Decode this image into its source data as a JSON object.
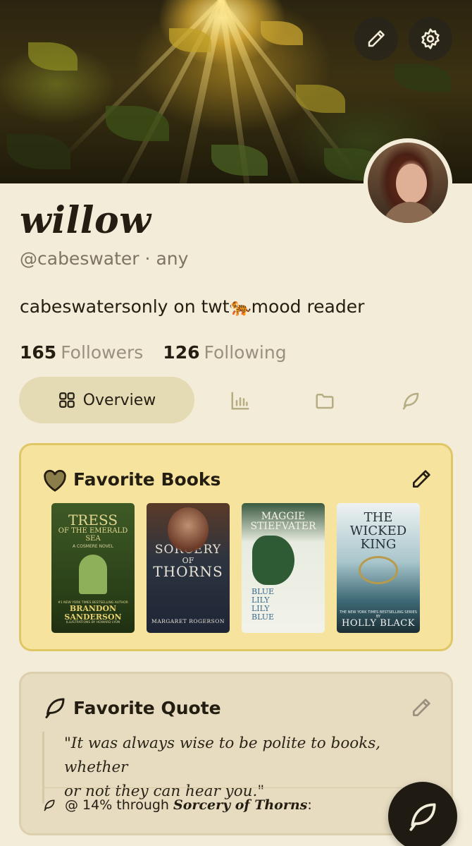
{
  "profile": {
    "display_name": "willow",
    "handle": "@cabeswater",
    "pronouns": "any",
    "handle_separator": "·",
    "bio": "cabeswatersonly on twt🐅mood reader",
    "followers_count": "165",
    "followers_label": "Followers",
    "following_count": "126",
    "following_label": "Following"
  },
  "header_actions": {
    "edit_icon": "pencil-icon",
    "settings_icon": "gear-icon"
  },
  "tabs": [
    {
      "label": "Overview",
      "icon": "grid-icon",
      "active": true
    },
    {
      "label": "",
      "icon": "bar-chart-icon",
      "active": false
    },
    {
      "label": "",
      "icon": "folder-icon",
      "active": false
    },
    {
      "label": "",
      "icon": "feather-icon",
      "active": false
    }
  ],
  "favorite_books": {
    "title": "Favorite Books",
    "books": [
      {
        "cover_title": "TRESS",
        "cover_subtitle": "OF THE EMERALD SEA",
        "cover_series": "A COSMERE NOVEL",
        "cover_blurb": "#1 NEW YORK TIMES BESTSELLING AUTHOR",
        "cover_author": "BRANDON SANDERSON",
        "cover_credit": "ILLUSTRATIONS BY HOWARD LYON"
      },
      {
        "cover_title": "SORCERY",
        "cover_subtitle": "OF",
        "cover_title2": "THORNS",
        "cover_author": "MARGARET ROGERSON"
      },
      {
        "cover_author": "MAGGIE STIEFVATER",
        "cover_title": "BLUE LILY LILY BLUE"
      },
      {
        "cover_title": "THE WICKED KING",
        "cover_blurb": "THE NEW YORK TIMES BESTSELLING SERIES BY",
        "cover_author": "HOLLY BLACK"
      }
    ]
  },
  "favorite_quote": {
    "title": "Favorite Quote",
    "quote_line1": "\"It was always wise to be polite to books,  whether",
    "quote_line2": "or not they can hear you.\"",
    "progress_prefix": "@ 14% through",
    "progress_book": "Sorcery of Thorns",
    "progress_suffix": ":"
  },
  "colors": {
    "page_bg": "#f3ecd8",
    "books_card_bg": "#f6e39e",
    "books_card_border": "#e0c766",
    "quote_card_bg": "#e7dcc0",
    "active_tab_bg": "#e4dbb4",
    "fab_bg": "#1f1a12"
  }
}
